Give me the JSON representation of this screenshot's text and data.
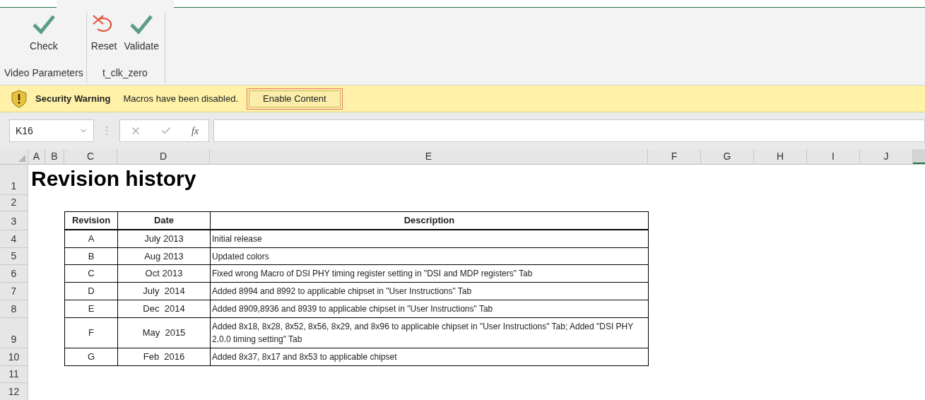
{
  "ribbon": {
    "groups": [
      {
        "label": "Video Parameters",
        "buttons": [
          {
            "label": "Check",
            "kind": "check"
          }
        ]
      },
      {
        "label": "t_clk_zero",
        "buttons": [
          {
            "label": "Reset",
            "kind": "reset"
          },
          {
            "label": "Validate",
            "kind": "check"
          }
        ]
      }
    ]
  },
  "security_bar": {
    "title": "Security Warning",
    "message": "Macros have been disabled.",
    "button": "Enable Content"
  },
  "formula_bar": {
    "name_box": "K16",
    "function_label": "fx"
  },
  "column_headers": [
    "A",
    "B",
    "C",
    "D",
    "E",
    "F",
    "G",
    "H",
    "I",
    "J"
  ],
  "row_headers": [
    "1",
    "2",
    "3",
    "4",
    "5",
    "6",
    "7",
    "8",
    "9",
    "10",
    "11",
    "12"
  ],
  "sheet": {
    "title": "Revision history",
    "table": {
      "columns": [
        "Revision",
        "Date",
        "Description"
      ],
      "rows": [
        {
          "revision": "A",
          "date": "July 2013",
          "description": "Initial release"
        },
        {
          "revision": "B",
          "date": "Aug 2013",
          "description": "Updated colors"
        },
        {
          "revision": "C",
          "date": "Oct 2013",
          "description": "Fixed wrong Macro of DSI PHY timing register setting in \"DSI and MDP registers\" Tab"
        },
        {
          "revision": "D",
          "date": "July  2014",
          "description": "Added 8994 and 8992 to applicable chipset in \"User Instructions\" Tab"
        },
        {
          "revision": "E",
          "date": "Dec  2014",
          "description": "Added 8909,8936 and 8939 to applicable chipset in \"User Instructions\" Tab"
        },
        {
          "revision": "F",
          "date": "May  2015",
          "description": "Added 8x18, 8x28, 8x52, 8x56, 8x29, and 8x96 to applicable chipset in \"User Instructions\" Tab; Added \"DSI PHY 2.0.0 timing setting\" Tab"
        },
        {
          "revision": "G",
          "date": "Feb  2016",
          "description": "Added 8x37, 8x17 and 8x53 to applicable chipset"
        }
      ]
    }
  }
}
